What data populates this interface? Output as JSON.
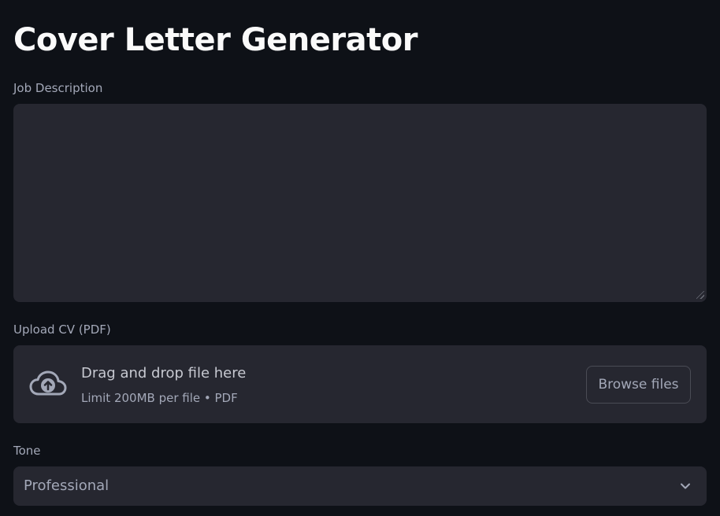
{
  "page": {
    "title": "Cover Letter Generator"
  },
  "job_description": {
    "label": "Job Description",
    "value": "",
    "placeholder": ""
  },
  "cv_upload": {
    "label": "Upload CV (PDF)",
    "icon": "cloud-upload-icon",
    "drop_text": "Drag and drop file here",
    "limit_text": "Limit 200MB per file • PDF",
    "browse_label": "Browse files"
  },
  "tone": {
    "label": "Tone",
    "selected": "Professional",
    "icon": "chevron-down-icon"
  },
  "colors": {
    "background": "#0e1117",
    "surface": "#262730",
    "text": "#fafafa",
    "muted": "#a3a8b8"
  }
}
